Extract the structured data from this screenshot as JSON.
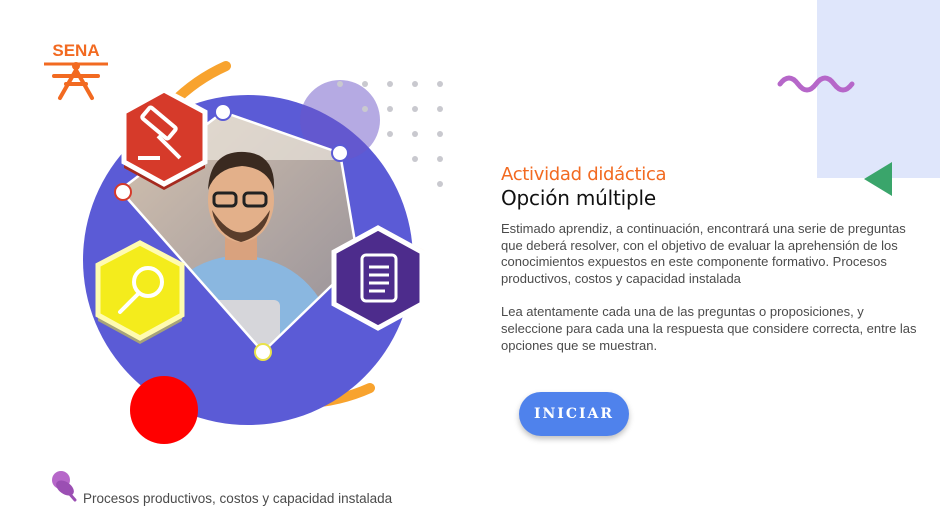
{
  "logo": {
    "text": "SENA",
    "icon": "sena-logo-icon",
    "color": "#f26a21"
  },
  "activity": {
    "kicker": "Actividad didáctica",
    "title": "Opción múltiple",
    "paragraph_1": "Estimado aprendiz, a continuación, encontrará una serie de preguntas que deberá resolver, con el objetivo de evaluar la aprehensión de los conocimientos expuestos en este componente formativo.  Procesos productivos, costos y capacidad instalada",
    "paragraph_2": "Lea atentamente cada una de las preguntas o proposiciones, y seleccione para cada una la respuesta que considere correcta, entre las opciones que se muestran."
  },
  "start_button": {
    "label": "INICIAR"
  },
  "footer": {
    "text": "Procesos productivos, costos y capacidad instalada",
    "icon": "pushpin-icon"
  },
  "colors": {
    "accent_orange": "#f26a21",
    "primary_blue": "#4f82ec",
    "circle_purple": "#5b5bd6",
    "hex_red": "#d63a2a",
    "hex_yellow": "#f4ec1c",
    "hex_purple": "#4d2c8c",
    "deco_panel": "#dfe6fb",
    "deco_green": "#3aa56b",
    "deco_wave": "#b667c9"
  },
  "icons": [
    "gavel-icon",
    "magnifier-icon",
    "scroll-icon",
    "pushpin-icon",
    "sena-logo-icon"
  ]
}
